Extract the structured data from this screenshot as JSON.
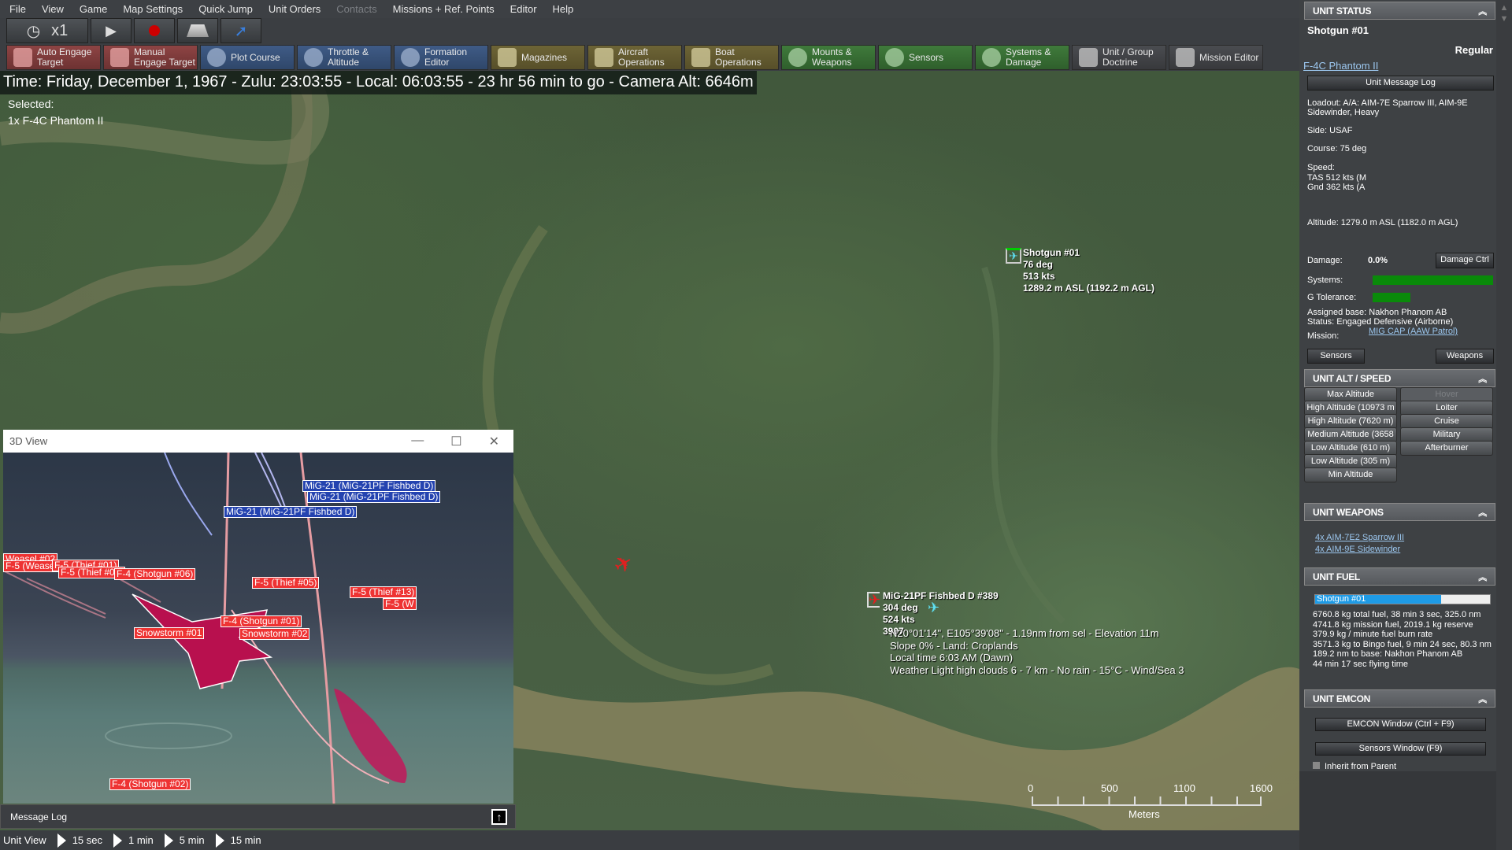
{
  "menu": [
    "File",
    "View",
    "Game",
    "Map Settings",
    "Quick Jump",
    "Unit Orders",
    "Contacts",
    "Missions + Ref. Points",
    "Editor",
    "Help"
  ],
  "menu_disabled": [
    "Contacts"
  ],
  "toolbar1": {
    "speed": "x1",
    "icons": [
      "clock-icon",
      "play-icon",
      "record-icon",
      "layers-icon",
      "jump-icon"
    ]
  },
  "toolbar2": [
    {
      "label": "Auto Engage Target",
      "color": "red",
      "icon": "auto-engage-icon"
    },
    {
      "label": "Manual Engage Target",
      "color": "red",
      "icon": "manual-engage-icon"
    },
    {
      "label": "Plot Course",
      "color": "blue",
      "icon": "plot-course-icon"
    },
    {
      "label": "Throttle & Altitude",
      "color": "blue",
      "icon": "throttle-icon"
    },
    {
      "label": "Formation Editor",
      "color": "blue",
      "icon": "formation-icon"
    },
    {
      "label": "Magazines",
      "color": "olive",
      "icon": "magazines-icon"
    },
    {
      "label": "Aircraft Operations",
      "color": "olive",
      "icon": "aircraft-icon"
    },
    {
      "label": "Boat Operations",
      "color": "olive",
      "icon": "boat-icon"
    },
    {
      "label": "Mounts & Weapons",
      "color": "green",
      "icon": "weapons-icon"
    },
    {
      "label": "Sensors",
      "color": "green",
      "icon": "sensors-icon"
    },
    {
      "label": "Systems & Damage",
      "color": "green",
      "icon": "gear-icon"
    },
    {
      "label": "Unit / Group Doctrine",
      "color": "gray",
      "icon": "doctrine-icon"
    },
    {
      "label": "Mission Editor",
      "color": "gray",
      "icon": "mission-editor-icon"
    }
  ],
  "timebar": "Time: Friday, December 1, 1967 - Zulu: 23:03:55 - Local: 06:03:55 - 23 hr 56 min to go -  Camera Alt: 6646m",
  "selected": {
    "label": "Selected:",
    "unit": "1x F-4C Phantom II"
  },
  "map": {
    "friendly": {
      "name": "Shotgun #01",
      "course": "76 deg",
      "speed": "513 kts",
      "alt": "1289.2 m ASL (1192.2 m AGL)"
    },
    "hostile": {
      "name": "MiG-21PF Fishbed D #389",
      "course": "304 deg",
      "speed": "524 kts",
      "alt": "3907"
    },
    "cursor_info": [
      "N20°01'14\", E105°39'08\" - 1.19nm from sel - Elevation 11m",
      "Slope 0%  - Land: Croplands",
      "Local time 6:03 AM (Dawn)",
      "Weather Light high clouds 6 - 7 km - No rain - 15°C - Wind/Sea 3"
    ],
    "scale": {
      "ticks": [
        "0",
        "500",
        "1100",
        "1600"
      ],
      "unit": "Meters"
    }
  },
  "view3d": {
    "title": "3D View",
    "labels_blue": [
      "MiG-21 (MiG-21PF Fishbed D)",
      "MiG-21 (MiG-21PF Fishbed D)",
      "MiG-21 (MiG-21PF Fishbed D)"
    ],
    "labels_red": [
      "Weasel #02",
      "F-5 (Weasel #01)",
      "F-5 (Thief #01)",
      "F-5 (Thief #02)",
      "F-4 (Shotgun #06)",
      "F-5 (Thief #05)",
      "F-5 (Thief #13)",
      "F-5 (W",
      "F-4 (Shotgun #01)",
      "Snowstorm #01",
      "Snowstorm #02",
      "F-4 (Shotgun #02)"
    ]
  },
  "message_log": "Message Log",
  "bottom": {
    "label": "Unit View",
    "steps": [
      "15 sec",
      "1 min",
      "5 min",
      "15 min"
    ]
  },
  "panel": {
    "status": {
      "header": "UNIT STATUS",
      "name": "Shotgun #01",
      "proficiency": "Regular",
      "class_link": "F-4C Phantom II",
      "msg_log_btn": "Unit Message Log",
      "loadout": "Loadout: A/A: AIM-7E Sparrow III, AIM-9E Sidewinder, Heavy",
      "side": "Side: USAF",
      "course": "Course: 75 deg",
      "speed_label": "Speed:",
      "tas": "TAS 512 kts (M",
      "gnd": "Gnd 362 kts (A",
      "altitude": "Altitude: 1279.0 m ASL (1182.0 m AGL)",
      "damage_label": "Damage:",
      "damage": "0.0%",
      "damage_btn": "Damage Ctrl",
      "systems_label": "Systems:",
      "systems_pct": 100,
      "g_label": "G Tolerance:",
      "g_pct": 30,
      "base": "Assigned base: Nakhon Phanom AB",
      "status": "Status: Engaged Defensive (Airborne)",
      "mission_label": "Mission:",
      "mission_link": "MIG CAP (AAW Patrol)",
      "sensors_btn": "Sensors",
      "weapons_btn": "Weapons"
    },
    "altspeed": {
      "header": "UNIT ALT / SPEED",
      "alt": [
        "Max Altitude",
        "High Altitude (10973 m",
        "High Altitude (7620 m)",
        "Medium Altitude (3658",
        "Low Altitude (610 m)",
        "Low Altitude (305 m)",
        "Min Altitude"
      ],
      "speed": [
        "Hover",
        "Loiter",
        "Cruise",
        "Military",
        "Afterburner"
      ]
    },
    "weapons": {
      "header": "UNIT WEAPONS",
      "items": [
        "4x AIM-7E2 Sparrow III",
        "4x AIM-9E Sidewinder"
      ]
    },
    "fuel": {
      "header": "UNIT FUEL",
      "bar_label": "Shotgun #01",
      "fuel_pct": 72,
      "lines": [
        "6760.8 kg total fuel, 38 min 3 sec, 325.0 nm",
        "4741.8 kg mission fuel, 2019.1 kg reserve",
        "379.9 kg / minute fuel burn rate",
        "3571.3 kg to Bingo fuel, 9 min 24 sec, 80.3 nm",
        "189.2 nm to base: Nakhon Phanom AB",
        "44 min 17 sec flying time"
      ]
    },
    "emcon": {
      "header": "UNIT EMCON",
      "emcon_btn": "EMCON Window (Ctrl + F9)",
      "sensors_btn": "Sensors Window (F9)",
      "inherit": "Inherit from Parent"
    }
  },
  "colors": {
    "fuel_bar": "#1e9be6",
    "health_bar": "#0a8a0a",
    "link": "#9cc7ef"
  }
}
